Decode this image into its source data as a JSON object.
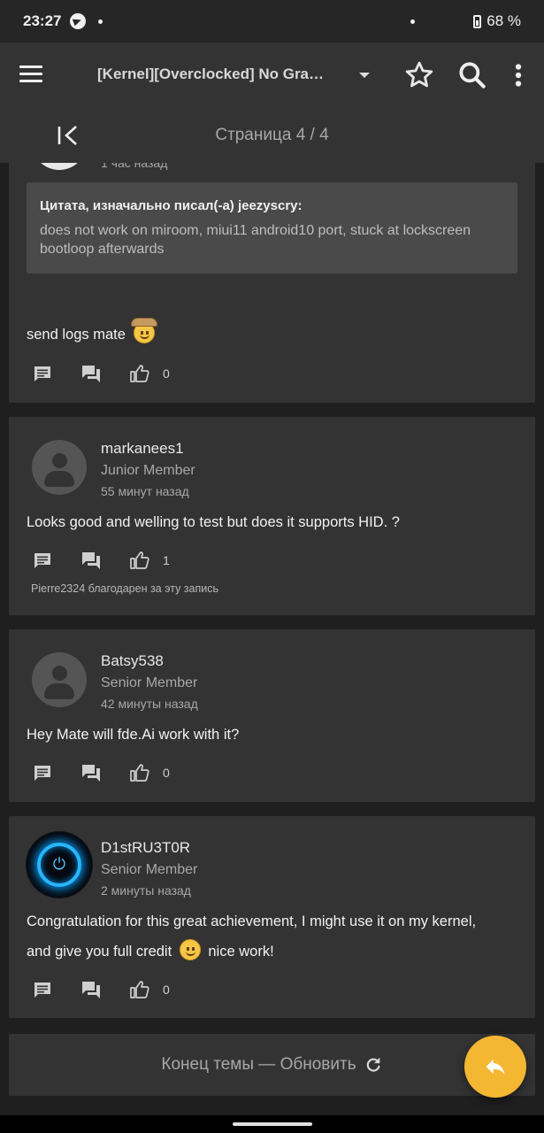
{
  "status_bar": {
    "time": "23:27",
    "battery": "68 %"
  },
  "toolbar": {
    "title": "[Kernel][Overclocked] No Gravity"
  },
  "pager": {
    "label": "Страница 4 / 4"
  },
  "posts": [
    {
      "time": "1 час назад",
      "quote_header": "Цитата, изначально писал(-а) jeezyscry:",
      "quote_text": "does not work on miroom, miui11 android10 port, stuck at lockscreen bootloop afterwards",
      "message": "send logs mate",
      "likes": "0"
    },
    {
      "username": "markanees1",
      "rank": "Junior Member",
      "time": "55 минут назад",
      "message": "Looks good and welling to test but does it supports HID. ?",
      "likes": "1",
      "thanks": "Pierre2324 благодарен за эту запись"
    },
    {
      "username": "Batsy538",
      "rank": "Senior Member",
      "time": "42 минуты назад",
      "message": "Hey Mate will fde.Ai work with it?",
      "likes": "0"
    },
    {
      "username": "D1stRU3T0R",
      "rank": "Senior Member",
      "time": "2 минуты назад",
      "message_line1": "Congratulation for this great achievement, I might use it on my kernel,",
      "message_line2a": "and give you full credit",
      "message_line2b": "nice work!",
      "likes": "0"
    }
  ],
  "footer": {
    "end_label": "Конец темы — Обновить"
  },
  "colors": {
    "background": "#1f1f1f",
    "card": "#333333",
    "fab": "#f4b732",
    "quote": "#4a4a4a"
  },
  "icons": [
    "menu-icon",
    "chevron-down-icon",
    "star-icon",
    "search-icon",
    "more-vert-icon",
    "first-page-icon",
    "comment-icon",
    "forum-icon",
    "thumb-up-icon",
    "refresh-icon",
    "reply-icon"
  ]
}
